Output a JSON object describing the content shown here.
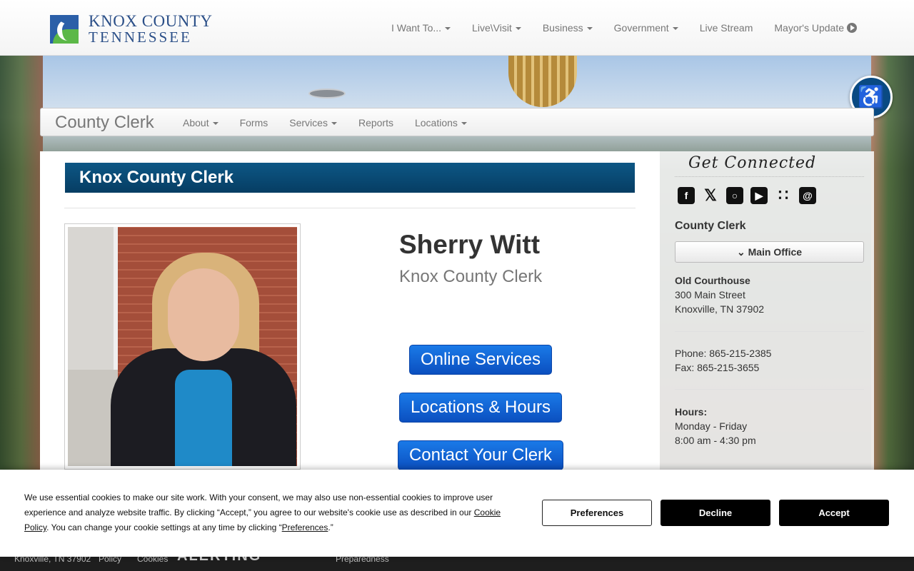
{
  "header": {
    "logo_line1": "KNOX COUNTY",
    "logo_line2": "TENNESSEE",
    "nav": [
      {
        "label": "I Want To..."
      },
      {
        "label": "Live\\Visit"
      },
      {
        "label": "Business"
      },
      {
        "label": "Government"
      },
      {
        "label": "Live Stream"
      },
      {
        "label": "Mayor's Update"
      }
    ]
  },
  "subnav": {
    "brand": "County Clerk",
    "items": [
      {
        "label": "About"
      },
      {
        "label": "Forms"
      },
      {
        "label": "Services"
      },
      {
        "label": "Reports"
      },
      {
        "label": "Locations"
      }
    ]
  },
  "main": {
    "heading": "Knox County Clerk",
    "person_name": "Sherry Witt",
    "person_title": "Knox County Clerk",
    "buttons": {
      "online_services": "Online Services",
      "locations_hours": "Locations & Hours",
      "contact_clerk": "Contact Your Clerk"
    }
  },
  "sidebar": {
    "get_connected": "Get Connected",
    "social_icons": [
      "facebook-icon",
      "x-icon",
      "instagram-icon",
      "youtube-icon",
      "rss-icon",
      "email-icon"
    ],
    "section_label": "County Clerk",
    "office_button": "Main Office",
    "building": "Old Courthouse",
    "street": "300 Main Street",
    "city": "Knoxville, TN 37902",
    "phone": "Phone: 865-215-2385",
    "fax": "Fax: 865-215-3655",
    "hours_label": "Hours:",
    "hours_days": "Monday - Friday",
    "hours_time": "8:00 am - 4:30 pm"
  },
  "footer": {
    "address": "Knoxville, TN 37902",
    "policy": "Policy",
    "cookies": "Cookies",
    "alerting": "ALERTING",
    "preparedness": "Preparedness"
  },
  "cookie": {
    "text_part1": "We use essential cookies to make our site work. With your consent, we may also use non-essential cookies to improve user experience and analyze website traffic. By clicking “Accept,” you agree to our website's cookie use as described in our ",
    "link_policy": "Cookie Policy",
    "text_part2": ". You can change your cookie settings at any time by clicking “",
    "link_prefs": "Preferences",
    "text_part3": ".”",
    "preferences_label": "Preferences",
    "decline_label": "Decline",
    "accept_label": "Accept"
  },
  "colors": {
    "brand_blue": "#2b4f88",
    "heading_bar": "#0d5785",
    "button_blue": "#1a7ae8",
    "a11y_blue": "#0a4a82"
  }
}
